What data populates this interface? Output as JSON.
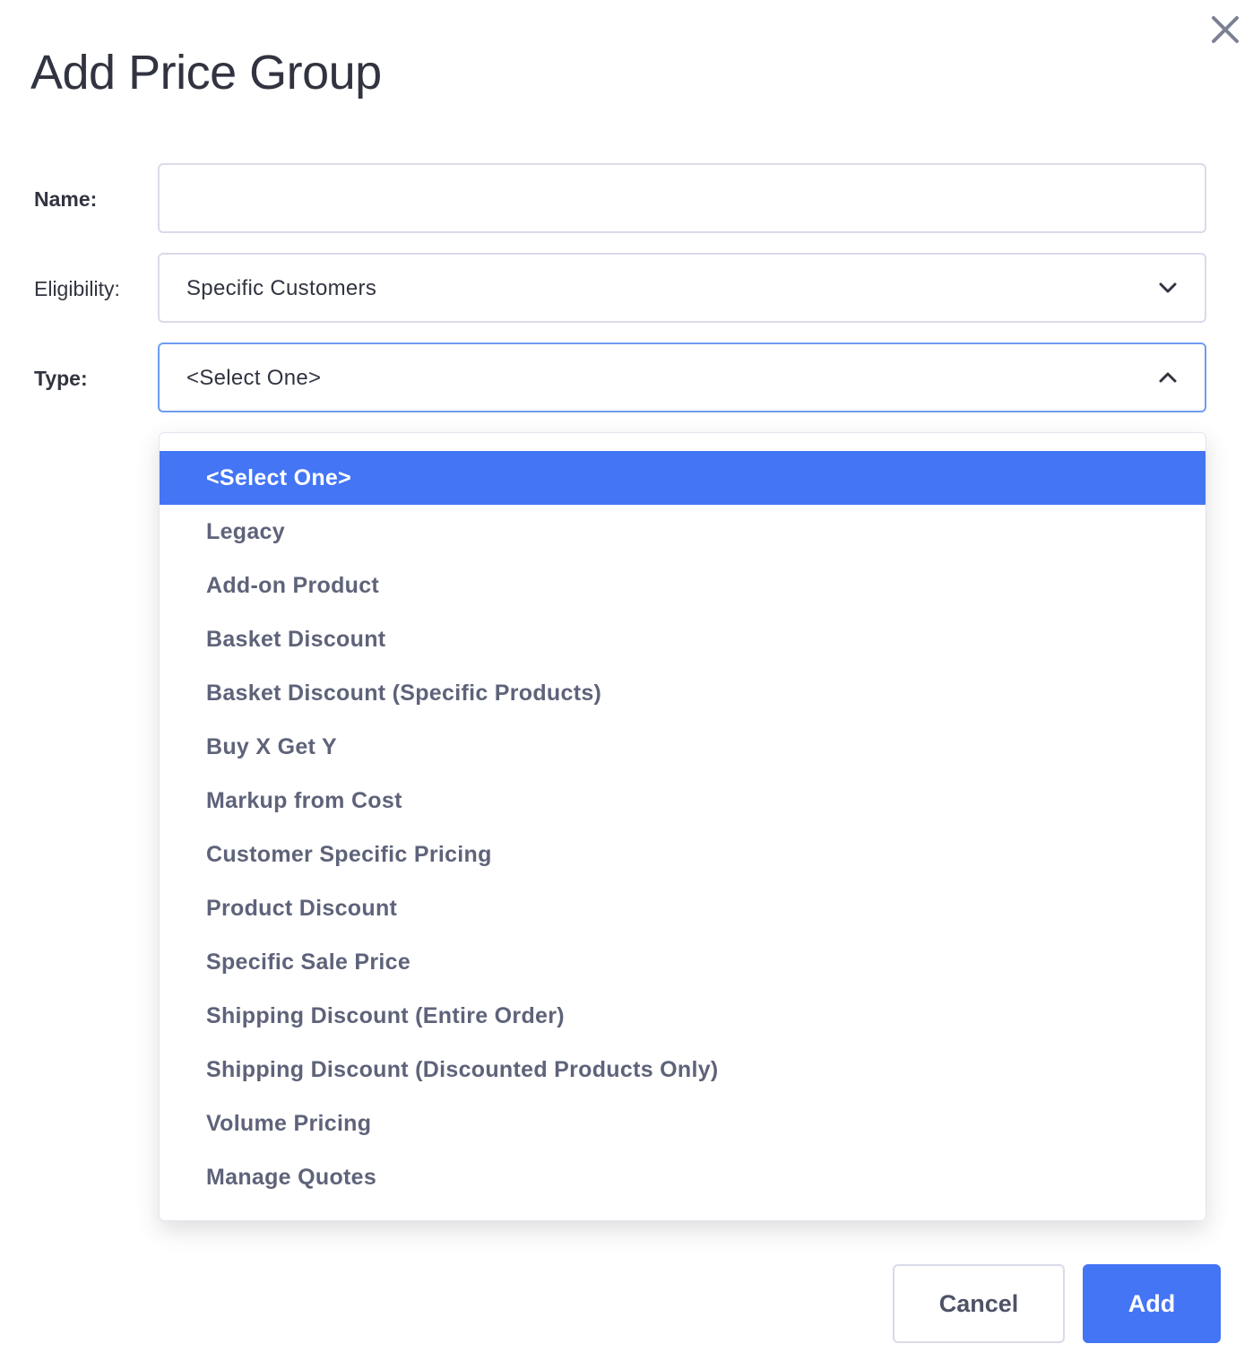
{
  "dialog": {
    "title": "Add Price Group",
    "close_icon": "close-icon"
  },
  "form": {
    "name": {
      "label": "Name:",
      "value": "",
      "placeholder": ""
    },
    "eligibility": {
      "label": "Eligibility:",
      "value": "Specific Customers",
      "icon": "chevron-down-icon"
    },
    "type": {
      "label": "Type:",
      "value": "<Select One>",
      "icon": "chevron-up-icon",
      "expanded": true,
      "options": [
        "<Select One>",
        "Legacy",
        "Add-on Product",
        "Basket Discount",
        "Basket Discount (Specific Products)",
        "Buy X Get Y",
        "Markup from Cost",
        "Customer Specific Pricing",
        "Product Discount",
        "Specific Sale Price",
        "Shipping Discount (Entire Order)",
        "Shipping Discount (Discounted Products Only)",
        "Volume Pricing",
        "Manage Quotes"
      ],
      "selected_index": 0
    }
  },
  "actions": {
    "cancel_label": "Cancel",
    "add_label": "Add"
  },
  "colors": {
    "accent": "#4375f5",
    "focus_border": "#6f9cf0",
    "border": "#d9dbe9",
    "text": "#313440",
    "option_text": "#5e637a"
  }
}
